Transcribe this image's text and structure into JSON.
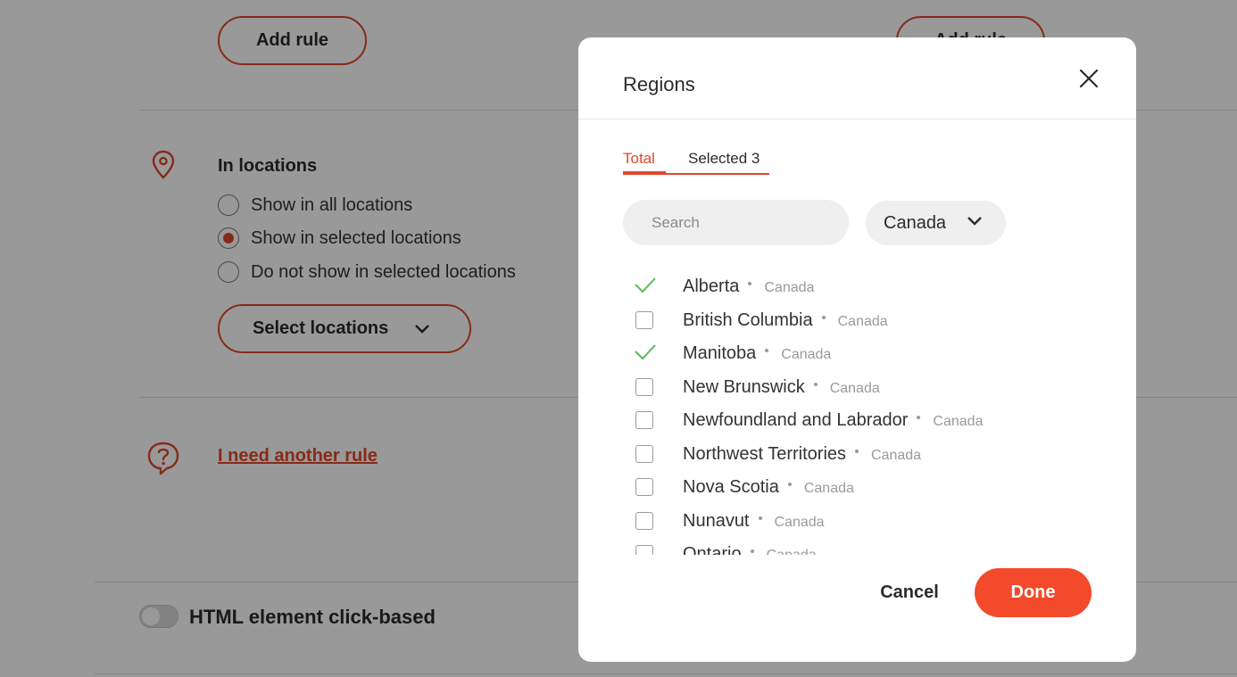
{
  "colors": {
    "accent": "#e0482b",
    "done_button": "#f24a2a",
    "check_green": "#5cb85c",
    "overlay": "rgba(0,0,0,0.40)"
  },
  "background": {
    "add_rule_label": "Add rule",
    "add_rule_label_2": "Add rule",
    "locations": {
      "title": "In locations",
      "options": [
        {
          "label": "Show in all locations",
          "checked": false
        },
        {
          "label": "Show in selected locations",
          "checked": true
        },
        {
          "label": "Do not show in selected locations",
          "checked": false
        }
      ],
      "select_button_label": "Select locations"
    },
    "another_rule_link": "I need another rule",
    "html_click_toggle": {
      "label": "HTML element click-based",
      "on": false
    }
  },
  "modal": {
    "title": "Regions",
    "tabs": [
      {
        "label": "Total",
        "active": true
      },
      {
        "label": "Selected 3",
        "active": false
      }
    ],
    "search": {
      "placeholder": "Search",
      "value": ""
    },
    "country_filter": {
      "selected": "Canada"
    },
    "regions": [
      {
        "name": "Alberta",
        "country": "Canada",
        "checked": true
      },
      {
        "name": "British Columbia",
        "country": "Canada",
        "checked": false
      },
      {
        "name": "Manitoba",
        "country": "Canada",
        "checked": true
      },
      {
        "name": "New Brunswick",
        "country": "Canada",
        "checked": false
      },
      {
        "name": "Newfoundland and Labrador",
        "country": "Canada",
        "checked": false
      },
      {
        "name": "Northwest Territories",
        "country": "Canada",
        "checked": false
      },
      {
        "name": "Nova Scotia",
        "country": "Canada",
        "checked": false
      },
      {
        "name": "Nunavut",
        "country": "Canada",
        "checked": false
      },
      {
        "name": "Ontario",
        "country": "Canada",
        "checked": false
      }
    ],
    "cancel_label": "Cancel",
    "done_label": "Done"
  }
}
